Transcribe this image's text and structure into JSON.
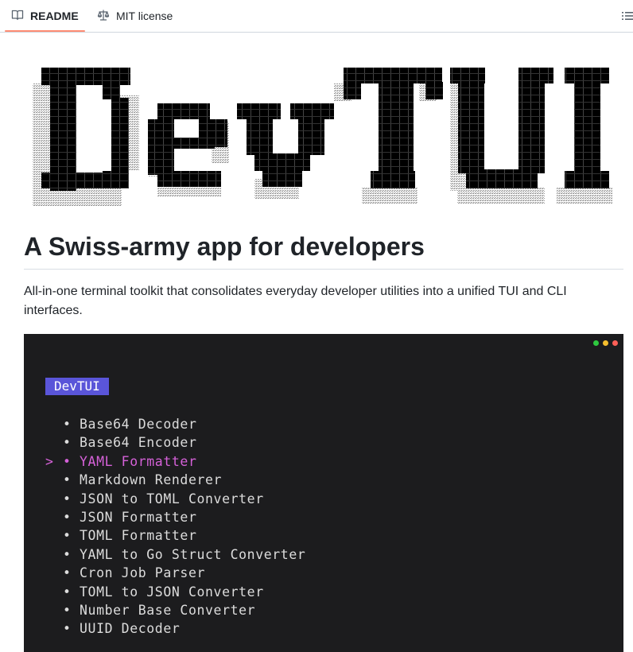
{
  "tabs": {
    "readme_label": "README",
    "license_label": "MIT license",
    "readme_icon": "book-icon",
    "license_icon": "scale-icon",
    "outline_icon": "list-unordered-icon"
  },
  "banner": {
    "text": "DevTUI"
  },
  "heading": "A Swiss-army app for developers",
  "description": "All-in-one terminal toolkit that consolidates everyday developer utilities into a unified TUI and CLI interfaces.",
  "terminal": {
    "title": "DevTUI",
    "cursor": ">",
    "bullet": "•",
    "selected_index": 2,
    "items": [
      "Base64 Decoder",
      "Base64 Encoder",
      "YAML Formatter",
      "Markdown Renderer",
      "JSON to TOML Converter",
      "JSON Formatter",
      "TOML Formatter",
      "YAML to Go Struct Converter",
      "Cron Job Parser",
      "TOML to JSON Converter",
      "Number Base Converter",
      "UUID Decoder"
    ],
    "colors": {
      "background": "#1c1c1e",
      "title_bg": "#5a55d9",
      "selected": "#d561d8",
      "text": "#dcdcdc"
    }
  }
}
